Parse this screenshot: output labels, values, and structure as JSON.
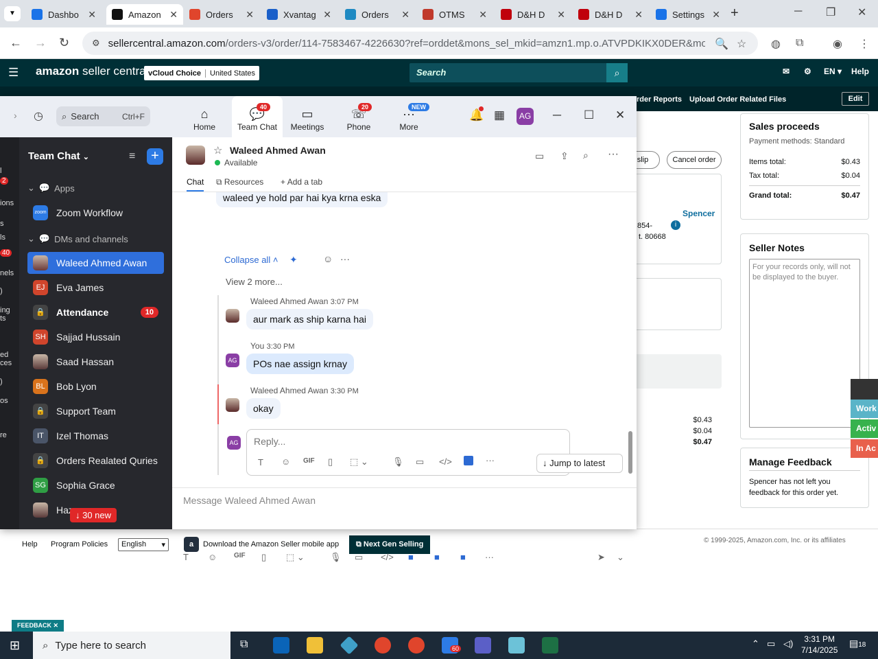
{
  "browser": {
    "tabs": [
      {
        "label": "Dashbo",
        "color": "#1a73e8"
      },
      {
        "label": "Amazon",
        "color": "#111111"
      },
      {
        "label": "Orders",
        "color": "#e0452c"
      },
      {
        "label": "Xvantag",
        "color": "#1a5fc9"
      },
      {
        "label": "Orders",
        "color": "#1f8ac2"
      },
      {
        "label": "OTMS",
        "color": "#c0392b"
      },
      {
        "label": "D&H D",
        "color": "#c0000c"
      },
      {
        "label": "D&H D",
        "color": "#c0000c"
      },
      {
        "label": "Settings",
        "color": "#1a73e8"
      }
    ],
    "url_host": "sellercentral.amazon.com",
    "url_path": "/orders-v3/order/114-7583467-4226630?ref=orddet&mons_sel_mkid=amzn1.mp.o.ATVPDKIKX0DER&mons_sel_m..."
  },
  "amazon": {
    "logo_main": "amazon",
    "logo_sub": " seller central",
    "store_name": "vCloud Choice",
    "store_region": "United States",
    "search_placeholder": "Search",
    "lang": "EN ▾",
    "help": "Help",
    "sublinks": [
      "rder Reports",
      "Upload Order Related Files"
    ],
    "edit": "Edit",
    "btn_slip": "slip",
    "btn_cancel": "Cancel order",
    "buyer_name": "Spencer",
    "address_frag1": "854-",
    "address_frag2": "t. 80668",
    "sales": {
      "title": "Sales proceeds",
      "payment": "Payment methods: Standard",
      "rows": [
        {
          "label": "Items total:",
          "value": "$0.43"
        },
        {
          "label": "Tax total:",
          "value": "$0.04"
        },
        {
          "label": "Grand total:",
          "value": "$0.47"
        }
      ]
    },
    "totals_frag": [
      "$0.43",
      "$0.04",
      "$0.47"
    ],
    "notes": {
      "title": "Seller Notes",
      "placeholder": "For your records only, will not be displayed to the buyer."
    },
    "feedback": {
      "title": "Manage Feedback",
      "text": "Spencer has not left you feedback for this order yet."
    },
    "footer": {
      "help": "Help",
      "policies": "Program Policies",
      "language": "English",
      "download": "Download the Amazon Seller mobile app",
      "ngs": "Next Gen Selling",
      "copyright": "© 1999-2025, Amazon.com, Inc. or its affiliates"
    },
    "side_widgets": [
      {
        "label": "Work",
        "color": "#5ab4c8"
      },
      {
        "label": "Activ",
        "color": "#37b24d"
      },
      {
        "label": "In Ac",
        "color": "#e8604c"
      }
    ],
    "feedback_tag": "FEEDBACK ✕"
  },
  "zoom": {
    "search_label": "Search",
    "search_shortcut": "Ctrl+F",
    "tabs": [
      {
        "label": "Home",
        "icon": "⌂"
      },
      {
        "label": "Team Chat",
        "icon": "💬",
        "badge": "40"
      },
      {
        "label": "Meetings",
        "icon": "▭"
      },
      {
        "label": "Phone",
        "icon": "☏",
        "badge": "20"
      },
      {
        "label": "More",
        "icon": "···",
        "badge": "NEW"
      }
    ],
    "avatar_initials": "AG",
    "rail_labels": [
      "l",
      "2",
      "ions",
      "s",
      "ls",
      "40",
      "nels",
      ")",
      "ing",
      "ts",
      "ed",
      "ces",
      ")",
      "os",
      "re"
    ],
    "sidebar": {
      "title": "Team Chat",
      "sections": {
        "apps": "Apps",
        "dms": "DMs and channels"
      },
      "items": [
        {
          "label": "Zoom Workflow",
          "initials": "zoom",
          "color": "#2d7be5"
        },
        {
          "label": "Waleed Ahmed Awan",
          "initials": "",
          "color": "#6b3a3a"
        },
        {
          "label": "Eva James",
          "initials": "EJ",
          "color": "#d0452c"
        },
        {
          "label": "Attendance",
          "initials": "🔒",
          "color": "#444",
          "count": "10"
        },
        {
          "label": "Sajjad Hussain",
          "initials": "SH",
          "color": "#d0452c"
        },
        {
          "label": "Saad Hassan",
          "initials": "",
          "color": "#5a3a3a"
        },
        {
          "label": "Bob Lyon",
          "initials": "BL",
          "color": "#d9731c"
        },
        {
          "label": "Support Team",
          "initials": "🔒",
          "color": "#444"
        },
        {
          "label": "Izel Thomas",
          "initials": "IT",
          "color": "#4a5568"
        },
        {
          "label": "Orders Realated Quries",
          "initials": "🔒",
          "color": "#444"
        },
        {
          "label": "Sophia Grace",
          "initials": "SG",
          "color": "#2f9e44"
        },
        {
          "label": "Haz",
          "initials": "",
          "color": "#5a3a3a"
        }
      ],
      "new_pill": "↓ 30 new"
    },
    "chat": {
      "name": "Waleed Ahmed Awan",
      "status": "Available",
      "tabs": {
        "chat": "Chat",
        "resources": "Resources",
        "add": "Add a tab"
      },
      "top_bubble": "waleed ye hold par hai kya krna eska",
      "collapse": "Collapse all",
      "view_more": "View 2 more...",
      "messages": [
        {
          "sender": "Waleed Ahmed Awan",
          "time": "3:07 PM",
          "text": "aur mark as ship karna hai"
        },
        {
          "sender": "You",
          "time": "3:30 PM",
          "text": "POs nae assign krnay"
        },
        {
          "sender": "Waleed Ahmed Awan",
          "time": "3:30 PM",
          "text": "okay"
        }
      ],
      "reply_placeholder": "Reply...",
      "jump_latest": "Jump to latest",
      "compose_placeholder": "Message Waleed Ahmed Awan"
    }
  },
  "taskbar": {
    "search": "Type here to search",
    "time": "3:31 PM",
    "date": "7/14/2025",
    "notif_count": "18",
    "zoom_badge": "60"
  }
}
